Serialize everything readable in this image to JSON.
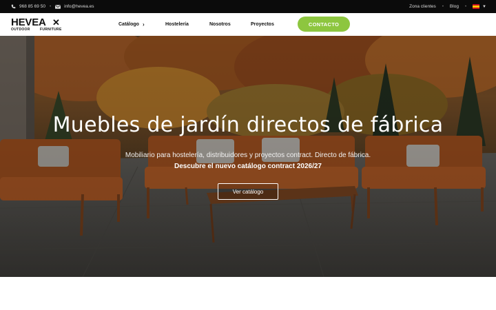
{
  "topbar": {
    "phone": "968 85 69 50",
    "email": "info@hevea.es",
    "phone_icon": "phone-icon",
    "email_icon": "mail-icon",
    "links": [
      "Zona clientes",
      "Blog"
    ],
    "language_flag": "spain-flag-icon"
  },
  "header": {
    "logo": {
      "brand": "HEVEA",
      "tagline_left": "OUTDOOR",
      "tagline_right": "FURNITURE"
    },
    "nav": {
      "catalogo": "Catálogo",
      "hosteleria": "Hostelería",
      "nosotros": "Nosotros",
      "proyectos": "Proyectos"
    },
    "cta_label": "CONTACTO",
    "cta_color": "#8dc63f"
  },
  "hero": {
    "title": "Muebles de jardín directos de fábrica",
    "subtitle": "Mobiliario para hostelería, distribuidores y proyectos contract. Directo de fábrica.",
    "highlight": "Descubre el nuevo catálogo contract 2026/27",
    "button_label": "Ver catálogo"
  }
}
